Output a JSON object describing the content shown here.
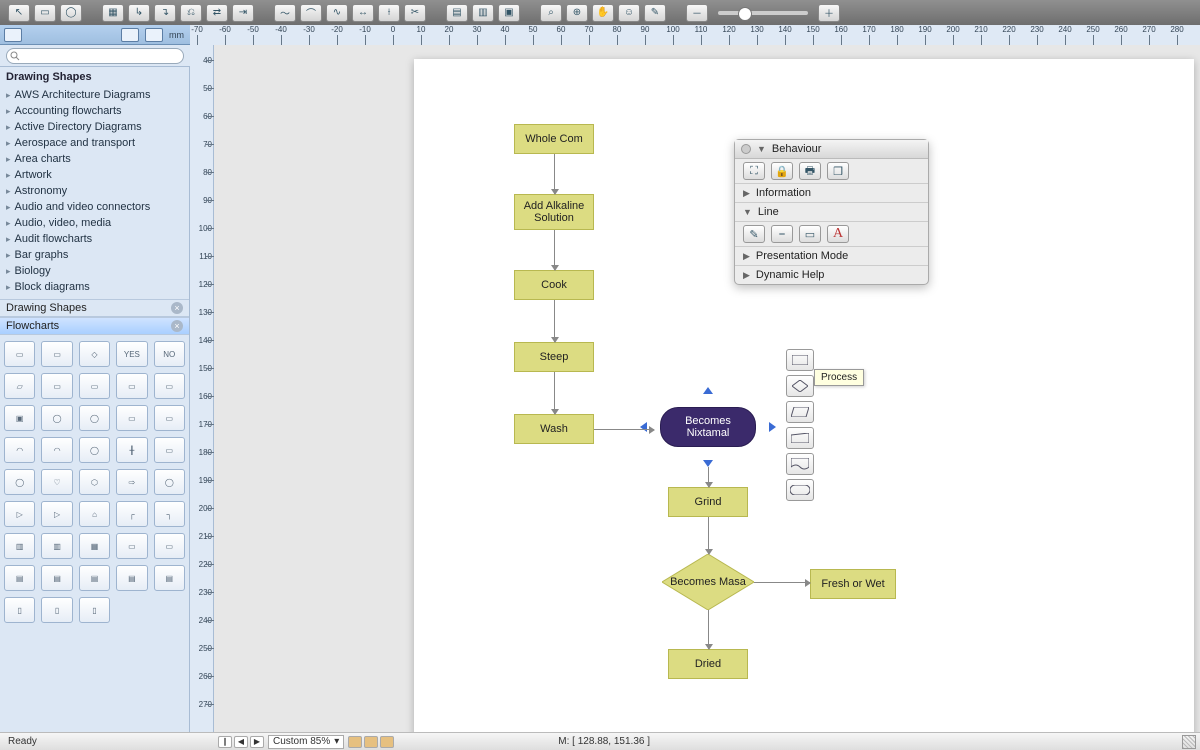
{
  "ruler_unit": "mm",
  "sidebar": {
    "search_placeholder": "",
    "categories_header": "Drawing Shapes",
    "categories": [
      "AWS Architecture Diagrams",
      "Accounting flowcharts",
      "Active Directory Diagrams",
      "Aerospace and transport",
      "Area charts",
      "Artwork",
      "Astronomy",
      "Audio and video connectors",
      "Audio, video, media",
      "Audit flowcharts",
      "Bar graphs",
      "Biology",
      "Block diagrams"
    ],
    "panel_headers": [
      "Drawing Shapes",
      "Flowcharts"
    ],
    "selected_panel_index": 1,
    "shape_labels": [
      "",
      "",
      "",
      "YES",
      "NO",
      "",
      "",
      "",
      "",
      "",
      "",
      "",
      "",
      "",
      "",
      "",
      "",
      "",
      "",
      "",
      "",
      "",
      "",
      "",
      "",
      "",
      "",
      "",
      "",
      "",
      "",
      "",
      "",
      "",
      "",
      "",
      "",
      "",
      "",
      "",
      "",
      "",
      ""
    ]
  },
  "canvas": {
    "nodes": {
      "whole_com": "Whole Com",
      "add_alkaline": "Add Alkaline Solution",
      "cook": "Cook",
      "steep": "Steep",
      "wash": "Wash",
      "becomes_nixtamal": "Becomes Nixtamal",
      "grind": "Grind",
      "becomes_masa": "Becomes Masa",
      "fresh_or_wet": "Fresh or Wet",
      "dried": "Dried"
    },
    "tooltip": "Process"
  },
  "panel": {
    "title": "Behaviour",
    "information": "Information",
    "line": "Line",
    "presentation": "Presentation Mode",
    "dynamic_help": "Dynamic Help"
  },
  "status": {
    "ready": "Ready",
    "zoom": "Custom 85%",
    "coord": "M: [ 128.88, 151.36 ]"
  },
  "hruler_ticks": [
    -70,
    -60,
    -50,
    -40,
    -30,
    -20,
    -10,
    0,
    10,
    20,
    30,
    40,
    50,
    60,
    70,
    80,
    90,
    100,
    110,
    120,
    130,
    140,
    150,
    160,
    170,
    180,
    190,
    200,
    210,
    220,
    230,
    240,
    250,
    260,
    270,
    280
  ],
  "vruler_ticks": [
    40,
    50,
    60,
    70,
    80,
    90,
    100,
    110,
    120,
    130,
    140,
    150,
    160,
    170,
    180,
    190,
    200,
    210,
    220,
    230,
    240,
    250,
    260,
    270
  ]
}
